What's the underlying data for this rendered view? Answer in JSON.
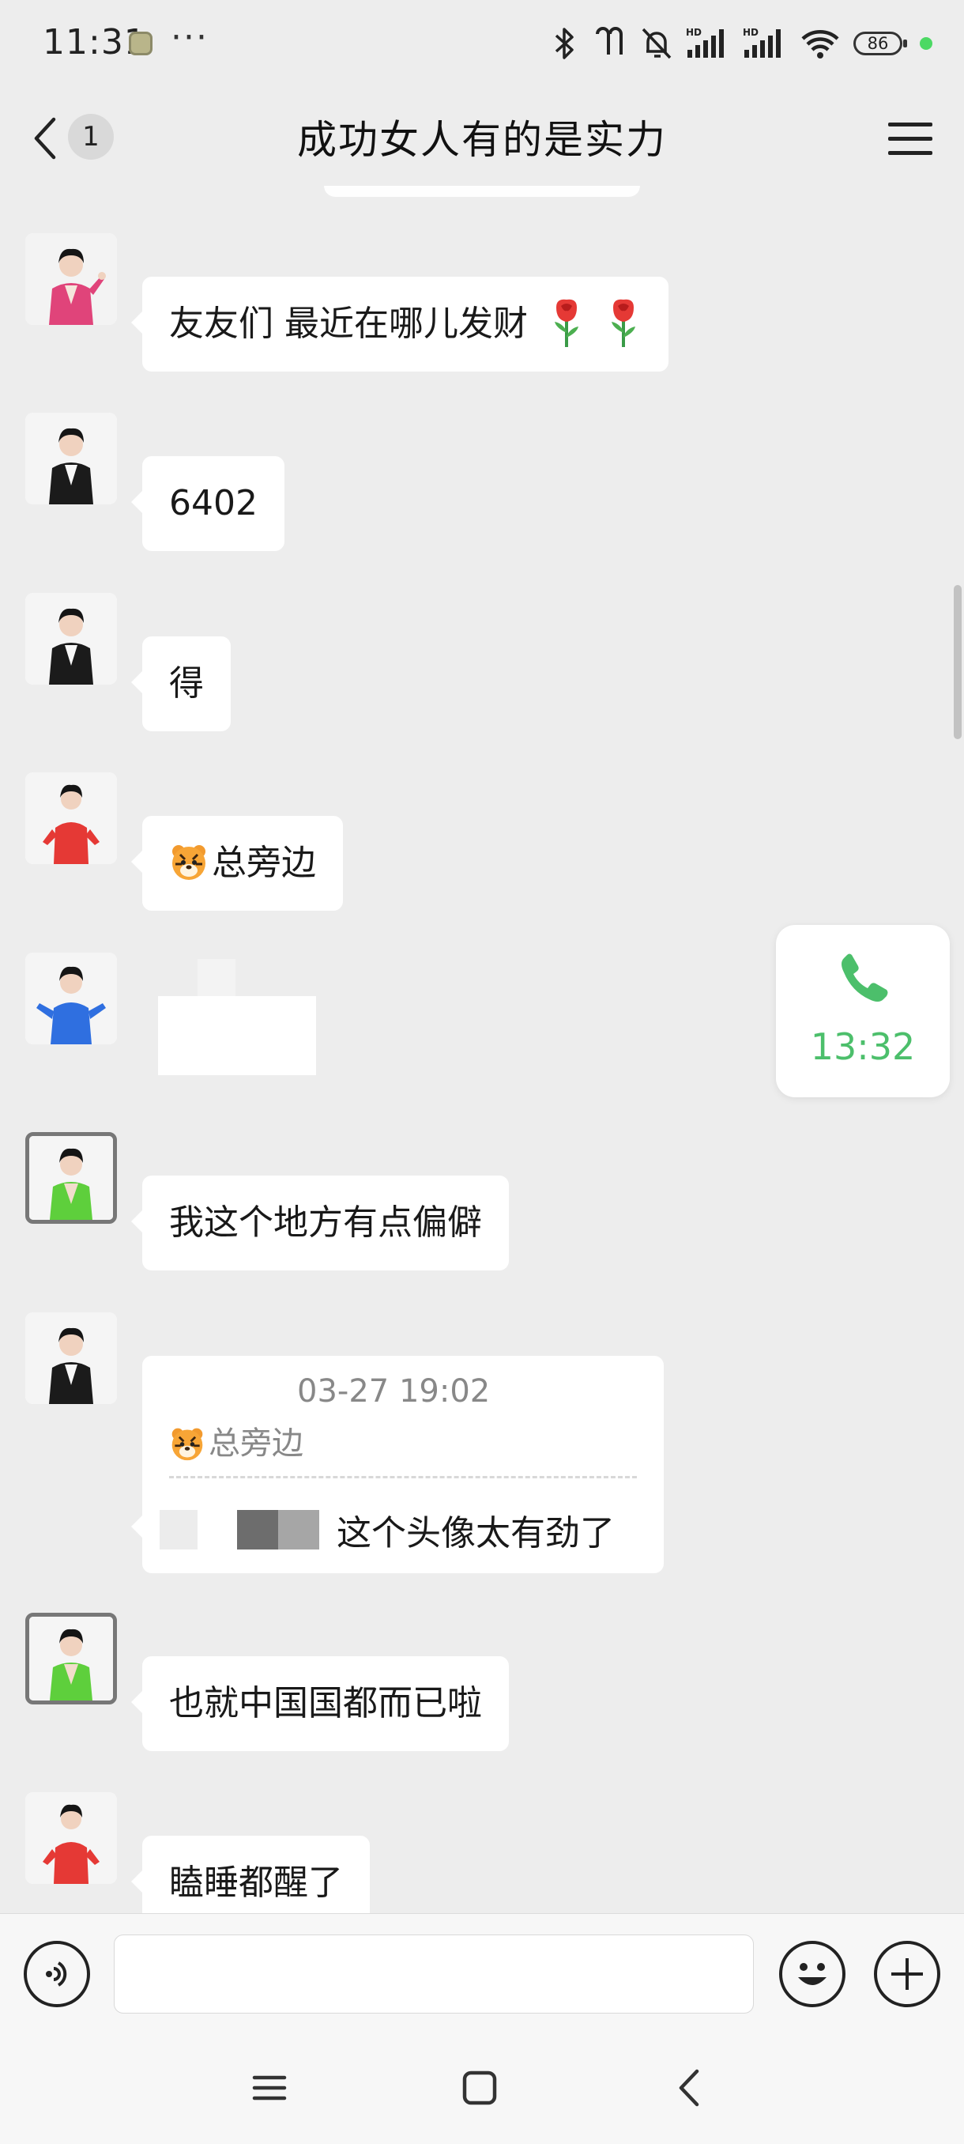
{
  "status_bar": {
    "time": "11:31",
    "more": "···",
    "battery": "86",
    "icons": [
      "app-icon",
      "bluetooth-icon",
      "earbuds-icon",
      "mute-icon",
      "hd-signal-icon",
      "hd-signal-icon",
      "wifi-icon",
      "battery-icon",
      "dot-icon"
    ]
  },
  "header": {
    "unread_count": "1",
    "title": "成功女人有的是实力",
    "back_icon": "chevron-left-icon",
    "menu_icon": "hamburger-menu-icon"
  },
  "messages": [
    {
      "avatar": "pink",
      "text": "友友们 最近在哪儿发财",
      "emoji": [
        "rose",
        "rose"
      ]
    },
    {
      "avatar": "black",
      "text": "6402"
    },
    {
      "avatar": "black",
      "text": "得"
    },
    {
      "avatar": "red",
      "emoji_prefix": "tiger",
      "text": "总旁边"
    },
    {
      "avatar": "blue",
      "text": ""
    },
    {
      "avatar": "green",
      "text": "我这个地方有点偏僻"
    },
    {
      "avatar": "black",
      "quote": {
        "time": "03-27 19:02",
        "sender": "总旁边",
        "sender_emoji": "tiger"
      },
      "text": "这个头像太有劲了"
    },
    {
      "avatar": "green",
      "text": "也就中国国都而已啦"
    },
    {
      "avatar": "red",
      "text": "瞌睡都醒了"
    }
  ],
  "call_card": {
    "time": "13:32",
    "icon": "phone-icon",
    "color": "#4cbf6b"
  },
  "input_bar": {
    "value": "",
    "placeholder": "",
    "voice_icon": "voice-icon",
    "emoji_icon": "smiley-icon",
    "plus_icon": "plus-icon"
  },
  "nav_bar": {
    "icons": [
      "menu-icon",
      "home-square-icon",
      "back-icon"
    ]
  },
  "colors": {
    "background": "#ededed",
    "bubble": "#ffffff",
    "accent_green": "#4cbf6b"
  }
}
